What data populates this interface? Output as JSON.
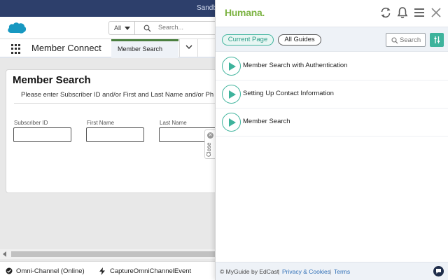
{
  "salesforce": {
    "topbar": {
      "environment_label": "Sandb"
    },
    "header": {
      "search_scope": "All",
      "search_placeholder": "Search..."
    },
    "nav": {
      "app_name": "Member Connect",
      "active_tab": "Member Search"
    },
    "member_search": {
      "title": "Member Search",
      "instructions": "Please enter Subscriber ID and/or First and Last Name and/or Ph",
      "fields": [
        {
          "label": "Subscriber ID",
          "value": ""
        },
        {
          "label": "First Name",
          "value": ""
        },
        {
          "label": "Last Name",
          "value": ""
        }
      ]
    },
    "utility_bar": {
      "omni_channel": "Omni-Channel (Online)",
      "capture_event": "CaptureOmniChannelEvent"
    },
    "close_tab_label": "Close"
  },
  "myguide": {
    "brand": "Humana.",
    "icons": [
      "refresh-icon",
      "bell-icon",
      "menu-icon",
      "close-icon"
    ],
    "filters": {
      "current_page": "Current Page",
      "all_guides": "All Guides",
      "selected": "Current Page"
    },
    "search_placeholder": "Search",
    "guides": [
      {
        "title": "Member Search with Authentication"
      },
      {
        "title": "Setting Up Contact Information"
      },
      {
        "title": "Member Search"
      }
    ],
    "footer": {
      "copyright": "© MyGuide by EdCast",
      "separator": "|",
      "privacy_link": "Privacy & Cookies",
      "terms_link": "Terms"
    },
    "colors": {
      "accent_teal": "#3eb39c",
      "brand_green": "#7cb342",
      "link_blue": "#2f6fb6"
    }
  }
}
